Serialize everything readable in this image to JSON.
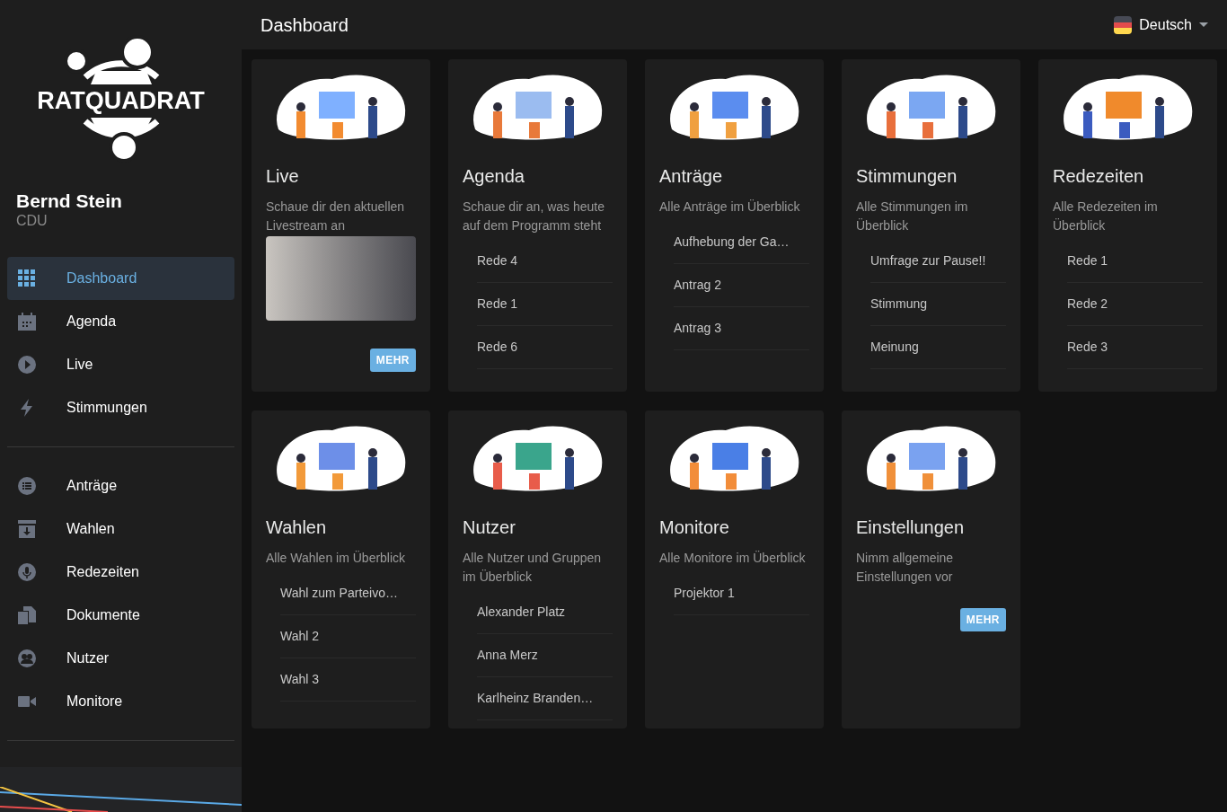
{
  "sidebar": {
    "logo": "RATQUADRAT",
    "user": {
      "name": "Bernd Stein",
      "party": "CDU"
    },
    "groups": [
      [
        {
          "label": "Dashboard",
          "selected": true
        },
        {
          "label": "Agenda",
          "selected": false
        },
        {
          "label": "Live",
          "selected": false
        },
        {
          "label": "Stimmungen",
          "selected": false
        }
      ],
      [
        {
          "label": "Anträge",
          "selected": false
        },
        {
          "label": "Wahlen",
          "selected": false
        },
        {
          "label": "Redezeiten",
          "selected": false
        },
        {
          "label": "Dokumente",
          "selected": false
        },
        {
          "label": "Nutzer",
          "selected": false
        },
        {
          "label": "Monitore",
          "selected": false
        }
      ]
    ]
  },
  "header": {
    "title": "Dashboard",
    "language": "Deutsch"
  },
  "cards": [
    {
      "kind": "media",
      "title": "Live",
      "description": "Schaue dir den aktuellen Livestream an",
      "button": "MEHR"
    },
    {
      "kind": "list",
      "title": "Agenda",
      "description": "Schaue dir an, was heute auf dem Programm steht",
      "items": [
        "Rede 4",
        "Rede 1",
        "Rede 6"
      ]
    },
    {
      "kind": "list",
      "title": "Anträge",
      "description": "Alle Anträge im Überblick",
      "items": [
        "Aufhebung der Ga…",
        "Antrag 2",
        "Antrag 3"
      ]
    },
    {
      "kind": "list",
      "title": "Stimmungen",
      "description": "Alle Stimmungen im Überblick",
      "items": [
        "Umfrage zur Pause!!",
        "Stimmung",
        "Meinung"
      ]
    },
    {
      "kind": "list",
      "title": "Redezeiten",
      "description": "Alle Redezeiten im Überblick",
      "items": [
        "Rede 1",
        "Rede 2",
        "Rede 3"
      ]
    },
    {
      "kind": "list",
      "title": "Wahlen",
      "description": "Alle Wahlen im Überblick",
      "items": [
        "Wahl zum Parteivo…",
        "Wahl 2",
        "Wahl 3"
      ]
    },
    {
      "kind": "list",
      "title": "Nutzer",
      "description": "Alle Nutzer und Gruppen im Überblick",
      "items": [
        "Alexander Platz",
        "Anna Merz",
        "Karlheinz Branden…"
      ]
    },
    {
      "kind": "list",
      "title": "Monitore",
      "description": "Alle Monitore im Überblick",
      "items": [
        "Projektor 1"
      ]
    },
    {
      "kind": "button",
      "title": "Einstellungen",
      "description": "Nimm allgemeine Einstellungen vor",
      "button": "MEHR"
    }
  ]
}
